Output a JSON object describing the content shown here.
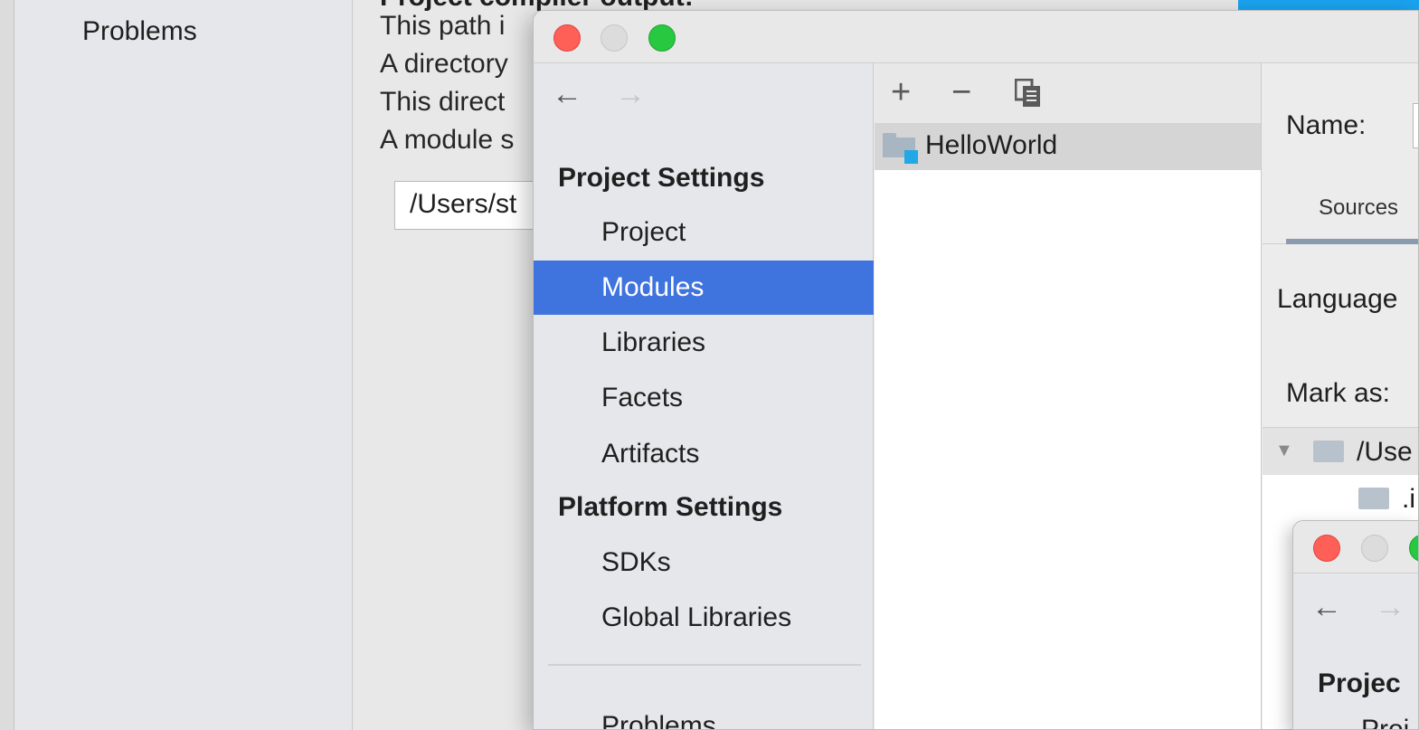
{
  "background": {
    "sidebar_item": "Problems",
    "cut_heading": "Project compiler output:",
    "lines": [
      "This path i",
      "A directory",
      "This direct",
      "A module s"
    ],
    "path_field": "/Users/st"
  },
  "dialog": {
    "nav": {
      "back_glyph": "←",
      "forward_glyph": "→"
    },
    "sidebar": {
      "project_settings_header": "Project Settings",
      "project_items": [
        "Project",
        "Modules",
        "Libraries",
        "Facets",
        "Artifacts"
      ],
      "platform_settings_header": "Platform Settings",
      "platform_items": [
        "SDKs",
        "Global Libraries"
      ],
      "problems": "Problems",
      "selected": "Modules"
    },
    "modules_toolbar": {
      "add_glyph": "+",
      "remove_glyph": "−",
      "copy_icon": "copy-icon"
    },
    "modules": [
      "HelloWorld"
    ],
    "detail": {
      "name_label": "Name:",
      "tab_sources": "Sources",
      "language_label": "Language",
      "mark_as_label": "Mark as:",
      "tree_root": "/Use",
      "tree_child": ".i"
    }
  },
  "dialog2": {
    "nav": {
      "back_glyph": "←",
      "forward_glyph": "→"
    },
    "section": "Projec",
    "item": "Proj"
  },
  "colors": {
    "selection": "#3f73de",
    "accent_blue": "#1aa3f0",
    "close": "#fe5f57",
    "zoom": "#28c840",
    "module_badge": "#23a7e6"
  }
}
